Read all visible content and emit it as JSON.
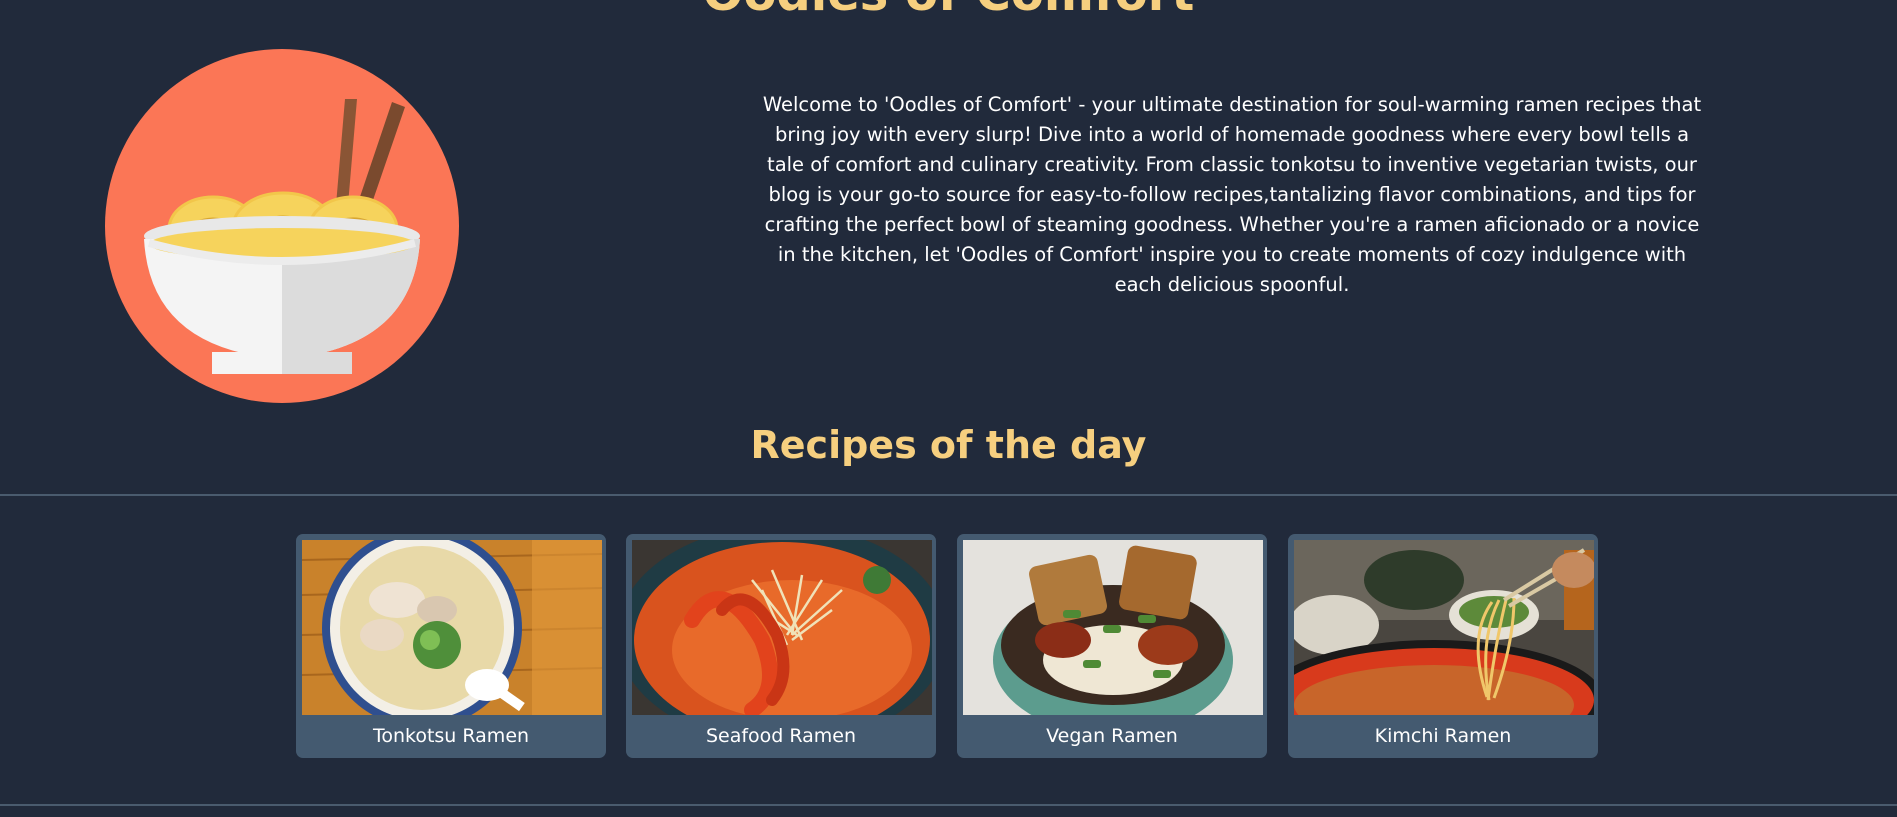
{
  "header": {
    "site_title": "Oodles of Comfort"
  },
  "hero": {
    "logo_icon": "ramen-bowl-icon",
    "intro": "Welcome to 'Oodles of Comfort' - your ultimate destination for soul-warming ramen recipes that bring joy with every slurp! Dive into a world of homemade goodness where every bowl tells a tale of comfort and culinary creativity. From classic tonkotsu to inventive vegetarian twists, our blog is your go-to source for easy-to-follow recipes,tantalizing flavor combinations, and tips for crafting the perfect bowl of steaming goodness. Whether you're a ramen aficionado or a novice in the kitchen, let 'Oodles of Comfort' inspire you to create moments of cozy indulgence with each delicious spoonful."
  },
  "recipes": {
    "section_title": "Recipes of the day",
    "cards": [
      {
        "label": "Tonkotsu Ramen"
      },
      {
        "label": "Seafood Ramen"
      },
      {
        "label": "Vegan Ramen"
      },
      {
        "label": "Kimchi Ramen"
      }
    ]
  },
  "colors": {
    "background": "#212a3b",
    "heading": "#f6cf7f",
    "card": "#445a70",
    "logo_circle": "#fb7656"
  }
}
